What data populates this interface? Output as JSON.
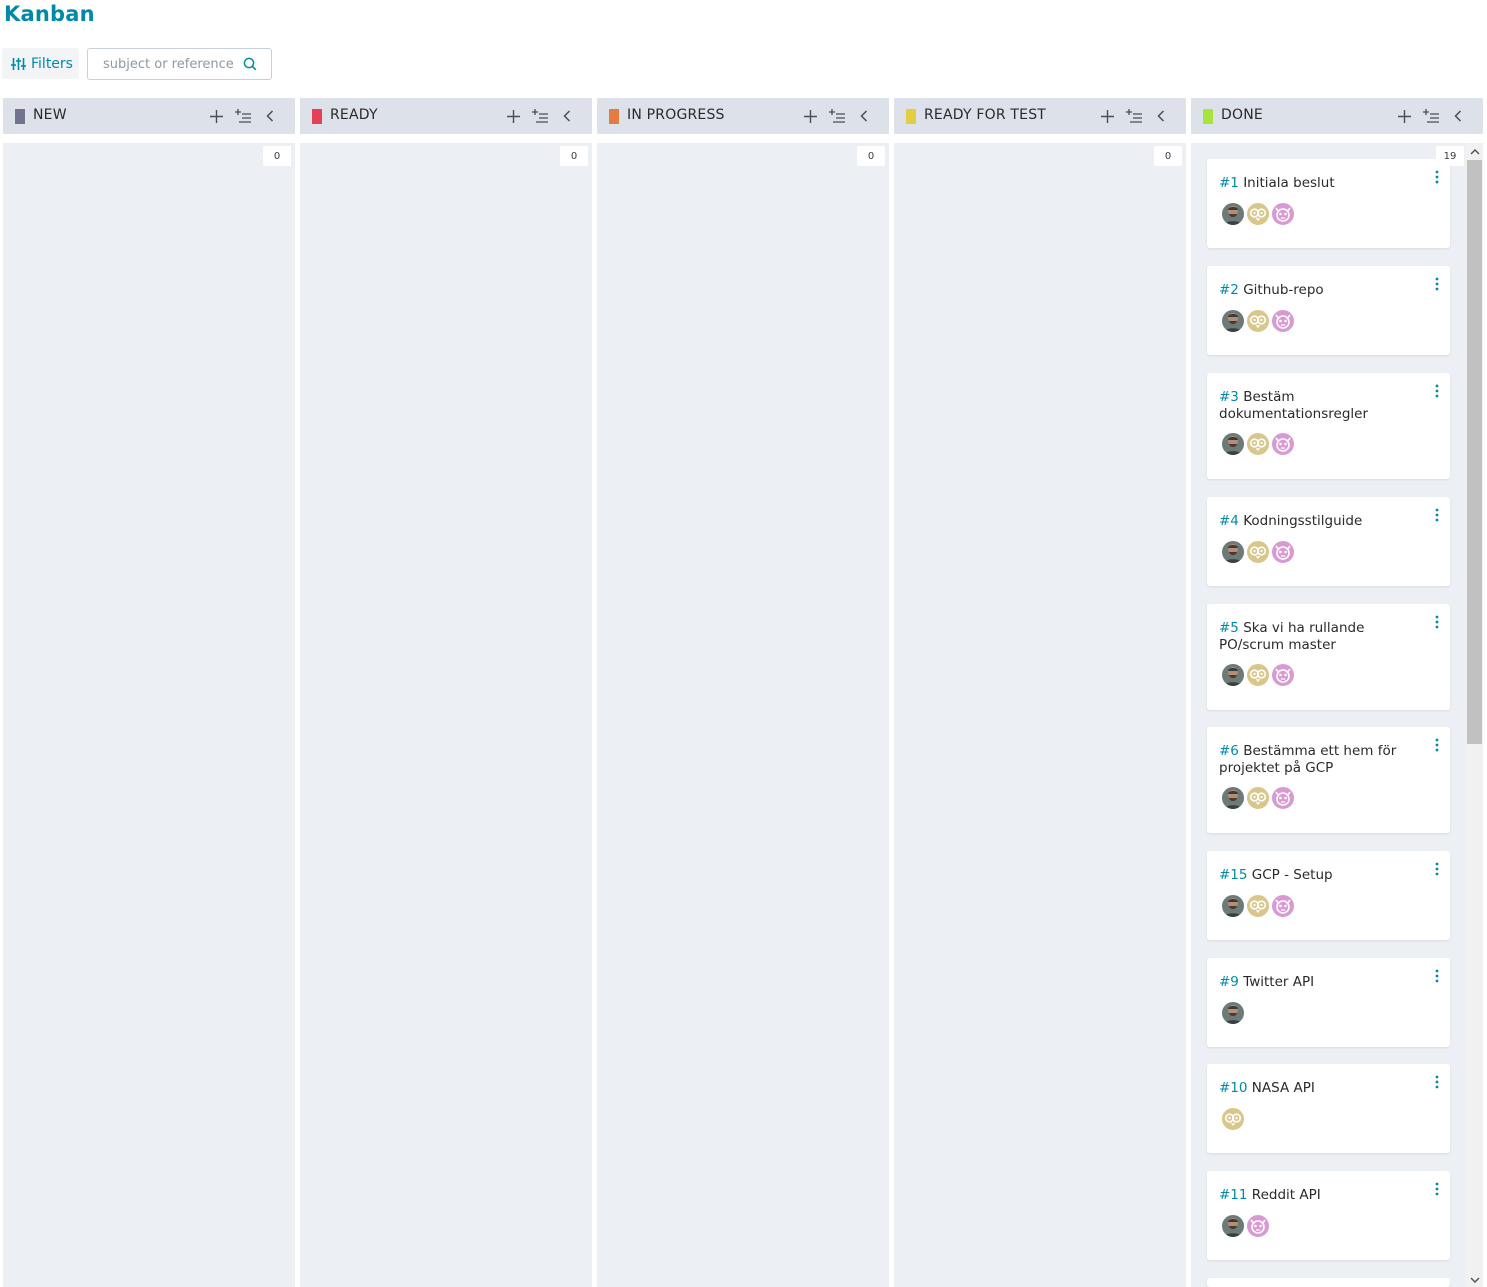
{
  "page": {
    "title": "Kanban"
  },
  "toolbar": {
    "filters_label": "Filters",
    "search_placeholder": "subject or reference",
    "search_value": ""
  },
  "columns": [
    {
      "name": "NEW",
      "color": "#71738e",
      "count": "0"
    },
    {
      "name": "READY",
      "color": "#e44057",
      "count": "0"
    },
    {
      "name": "IN PROGRESS",
      "color": "#e47c40",
      "count": "0"
    },
    {
      "name": "READY FOR TEST",
      "color": "#e4ce40",
      "count": "0"
    },
    {
      "name": "DONE",
      "color": "#a8e440",
      "count": "19"
    }
  ],
  "column_actions": [
    "add-icon",
    "bulk-add-icon",
    "fold-icon"
  ],
  "cards": [
    {
      "ref": "#1",
      "subject": "Initiala beslut",
      "assignees": [
        "photo",
        "owl",
        "pink"
      ]
    },
    {
      "ref": "#2",
      "subject": "Github-repo",
      "assignees": [
        "photo",
        "owl",
        "pink"
      ]
    },
    {
      "ref": "#3",
      "subject": "Bestäm dokumentationsregler",
      "assignees": [
        "photo",
        "owl",
        "pink"
      ]
    },
    {
      "ref": "#4",
      "subject": "Kodningsstilguide",
      "assignees": [
        "photo",
        "owl",
        "pink"
      ]
    },
    {
      "ref": "#5",
      "subject": "Ska vi ha rullande PO/scrum master",
      "assignees": [
        "photo",
        "owl",
        "pink"
      ]
    },
    {
      "ref": "#6",
      "subject": "Bestämma ett hem för projektet på GCP",
      "assignees": [
        "photo",
        "owl",
        "pink"
      ]
    },
    {
      "ref": "#15",
      "subject": "GCP - Setup",
      "assignees": [
        "photo",
        "owl",
        "pink"
      ]
    },
    {
      "ref": "#9",
      "subject": "Twitter API",
      "assignees": [
        "photo"
      ]
    },
    {
      "ref": "#10",
      "subject": "NASA API",
      "assignees": [
        "owl"
      ]
    },
    {
      "ref": "#11",
      "subject": "Reddit API",
      "assignees": [
        "photo",
        "pink"
      ]
    }
  ]
}
